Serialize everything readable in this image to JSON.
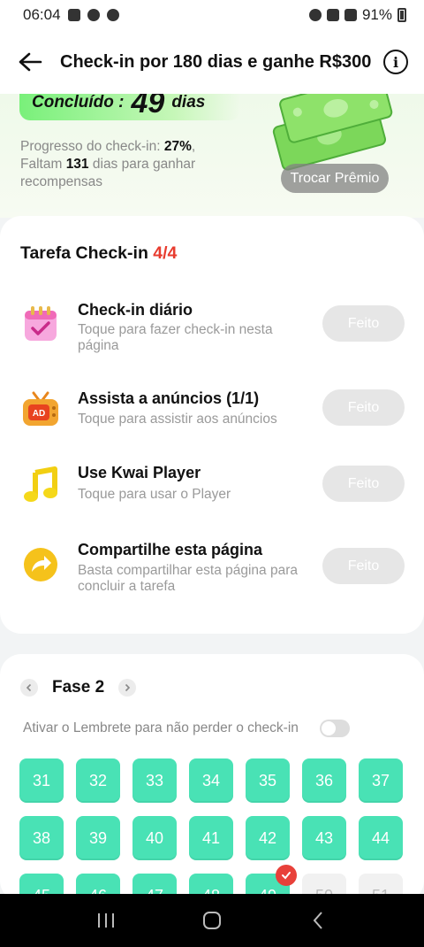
{
  "status_bar": {
    "time": "06:04",
    "battery": "91%"
  },
  "header": {
    "title": "Check-in por 180 dias e ganhe R$300"
  },
  "hero": {
    "done_label": "Concluído :",
    "done_number": "49",
    "done_unit": "dias",
    "progress_label": "Progresso do check-in:",
    "progress_percent": "27%",
    "remaining_prefix": "Faltam",
    "remaining_days": "131",
    "remaining_suffix": "dias para ganhar recompensas",
    "swap_label": "Trocar Prêmio"
  },
  "tasks": {
    "title": "Tarefa Check-in",
    "count": "4/4",
    "items": [
      {
        "name": "Check-in diário",
        "desc": "Toque para fazer check-in nesta página",
        "button": "Feito",
        "icon": "calendar-icon"
      },
      {
        "name": "Assista a anúncios  (1/1)",
        "desc": "Toque para assistir aos anúncios",
        "button": "Feito",
        "icon": "ad-tv-icon"
      },
      {
        "name": "Use Kwai Player",
        "desc": "Toque para usar o Player",
        "button": "Feito",
        "icon": "music-note-icon"
      },
      {
        "name": "Compartilhe esta página",
        "desc": "Basta compartilhar esta página para concluir a tarefa",
        "button": "Feito",
        "icon": "share-icon"
      }
    ]
  },
  "phase": {
    "title": "Fase 2",
    "reminder_text": "Ativar o Lembrete para não perder o check-in",
    "reminder_enabled": false,
    "days": [
      "31",
      "32",
      "33",
      "34",
      "35",
      "36",
      "37",
      "38",
      "39",
      "40",
      "41",
      "42",
      "43",
      "44",
      "45",
      "46",
      "47",
      "48",
      "49",
      "50",
      "51"
    ],
    "completed_through": "49"
  },
  "colors": {
    "accent_green": "#49e2b5",
    "alert_red": "#e83c2f",
    "done_gray": "#e6e6e6"
  }
}
